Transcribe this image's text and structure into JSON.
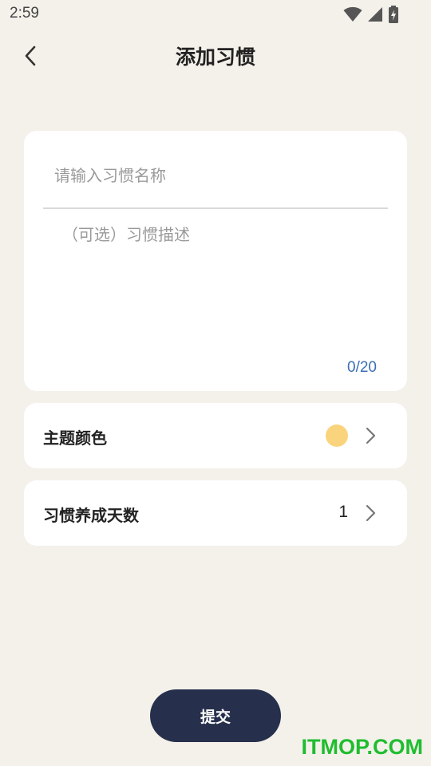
{
  "status_bar": {
    "time": "2:59",
    "icons": [
      "wifi-icon",
      "cellular-signal-icon",
      "battery-charging-icon"
    ]
  },
  "header": {
    "title": "添加习惯",
    "back_icon": "chevron-left-icon"
  },
  "habit_form": {
    "name_placeholder": "请输入习惯名称",
    "name_value": "",
    "description_placeholder": "（可选）习惯描述",
    "description_value": "",
    "char_count": "0/20"
  },
  "settings": {
    "theme_color": {
      "label": "主题颜色",
      "color": "#fad37d"
    },
    "habit_days": {
      "label": "习惯养成天数",
      "value": "1"
    }
  },
  "submit": {
    "label": "提交"
  },
  "watermark": {
    "text": "ITMOP.COM"
  },
  "colors": {
    "background": "#f4f1eb",
    "card": "#ffffff",
    "accent_text": "#3b6fb6",
    "submit_button": "#262f4b",
    "watermark": "#1fbd2f"
  }
}
